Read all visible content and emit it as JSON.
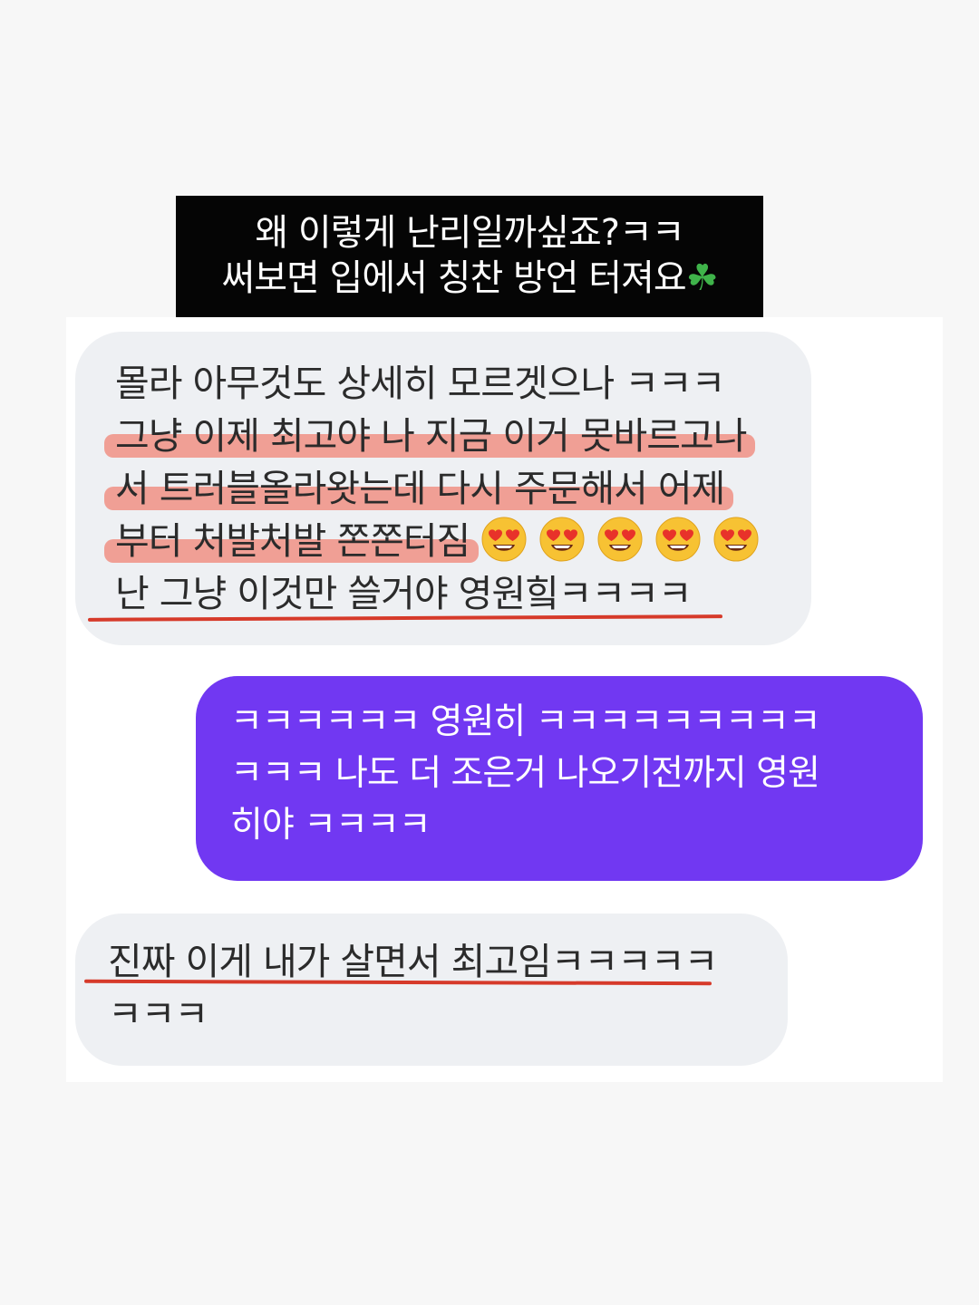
{
  "caption": {
    "line1": "왜 이렇게 난리일까싶죠?ㅋㅋ",
    "line2": "써보면 입에서 칭찬 방언 터져요",
    "line2_icon": "four-leaf-clover-icon"
  },
  "messages": {
    "received_1": {
      "line1": "몰라 아무것도 상세히 모르겟으나 ㅋㅋㅋ",
      "line2": "그냥 이제 최고야 나 지금 이거 못바르고나",
      "line3": "서 트러블올라왓는데 다시 주문해서 어제",
      "line4": "부터 처발처발 쫀쫀터짐",
      "line4_icons": [
        "heart-eyes-emoji",
        "heart-eyes-emoji",
        "heart-eyes-emoji",
        "heart-eyes-emoji",
        "heart-eyes-emoji"
      ],
      "line5": "난 그냥 이것만 쓸거야 영원힠ㅋㅋㅋㅋ"
    },
    "sent_1": {
      "line1": "ㅋㅋㅋㅋㅋㅋ 영원히 ㅋㅋㅋㅋㅋㅋㅋㅋㅋ",
      "line2": "ㅋㅋㅋ 나도 더 조은거 나오기전까지 영원",
      "line3": "히야 ㅋㅋㅋㅋ"
    },
    "received_2": {
      "line1": "진짜 이게 내가 살면서 최고임ㅋㅋㅋㅋㅋ",
      "line2": "ㅋㅋㅋ"
    }
  },
  "colors": {
    "caption_bg": "#050505",
    "received_bubble": "#eef0f3",
    "sent_bubble": "#7138f2",
    "highlight": "#f06e5a",
    "underline": "#d63a2a"
  }
}
